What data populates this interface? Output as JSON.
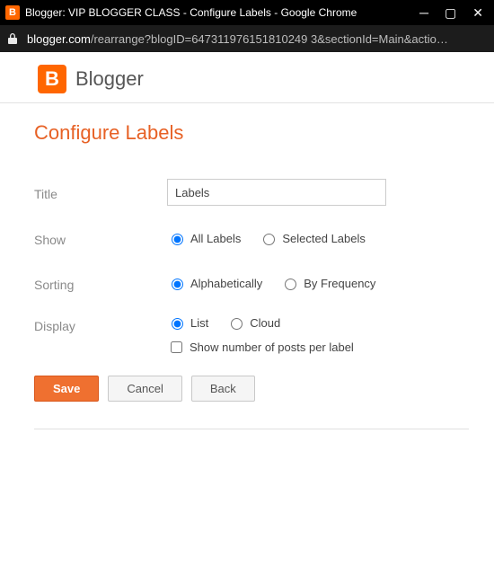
{
  "window": {
    "title": "Blogger: VIP BLOGGER CLASS - Configure Labels - Google Chrome"
  },
  "url": {
    "host": "blogger.com",
    "path": "/rearrange?blogID=647311976151810249 3&sectionId=Main&actio…"
  },
  "brand": {
    "name": "Blogger",
    "logo_letter": "B"
  },
  "page": {
    "title": "Configure Labels"
  },
  "form": {
    "title_label": "Title",
    "title_value": "Labels",
    "show_label": "Show",
    "show_option_all": "All Labels",
    "show_option_selected": "Selected Labels",
    "sorting_label": "Sorting",
    "sorting_option_alpha": "Alphabetically",
    "sorting_option_freq": "By Frequency",
    "display_label": "Display",
    "display_option_list": "List",
    "display_option_cloud": "Cloud",
    "post_count_label": "Show number of posts per label"
  },
  "buttons": {
    "save": "Save",
    "cancel": "Cancel",
    "back": "Back"
  }
}
